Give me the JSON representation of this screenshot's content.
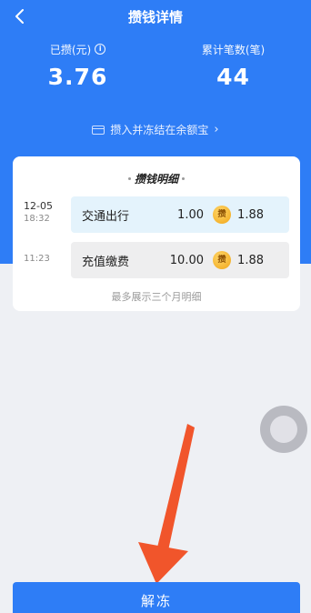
{
  "header": {
    "title": "攒钱详情",
    "stats": [
      {
        "label": "已攒(元)",
        "value": "3.76"
      },
      {
        "label": "累计笔数(笔)",
        "value": "44"
      }
    ],
    "info_icon": "info-icon",
    "deposit_link": "攒入并冻结在余额宝"
  },
  "detail": {
    "title": "攒钱明细",
    "rows": [
      {
        "date": "12-05",
        "time": "18:32",
        "category": "交通出行",
        "amount": "1.00",
        "coin_label": "攒",
        "saved": "1.88"
      },
      {
        "date": "",
        "time": "11:23",
        "category": "充值缴费",
        "amount": "10.00",
        "coin_label": "攒",
        "saved": "1.88"
      }
    ],
    "footnote": "最多展示三个月明细"
  },
  "action": {
    "unfreeze_label": "解冻"
  },
  "colors": {
    "primary": "#2e7df6",
    "highlight_row": "#e4f3fc",
    "arrow": "#f1552b"
  }
}
